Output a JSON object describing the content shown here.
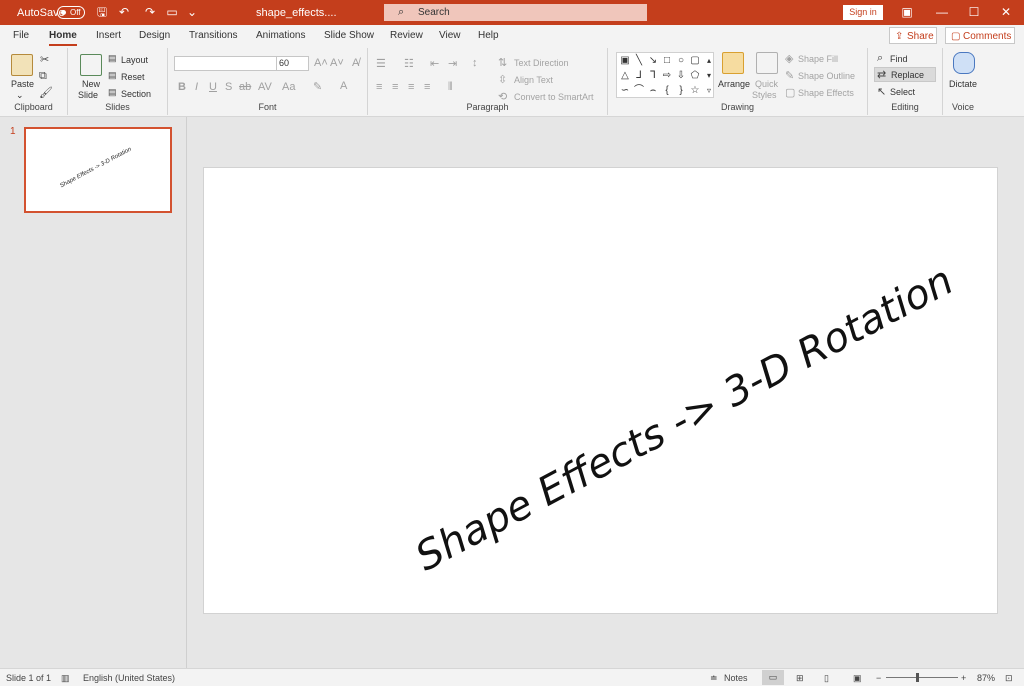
{
  "titlebar": {
    "autosave_label": "AutoSave",
    "autosave_state": "Off",
    "filename": "shape_effects....",
    "search_placeholder": "Search",
    "signin_label": "Sign in"
  },
  "tabs": [
    "File",
    "Home",
    "Insert",
    "Design",
    "Transitions",
    "Animations",
    "Slide Show",
    "Review",
    "View",
    "Help"
  ],
  "active_tab": "Home",
  "share_label": "Share",
  "comments_label": "Comments",
  "ribbon": {
    "clipboard": {
      "label": "Clipboard",
      "paste": "Paste"
    },
    "slides": {
      "label": "Slides",
      "new_slide_1": "New",
      "new_slide_2": "Slide",
      "layout": "Layout",
      "reset": "Reset",
      "section": "Section"
    },
    "font": {
      "label": "Font",
      "size": "60"
    },
    "paragraph": {
      "label": "Paragraph",
      "text_direction": "Text Direction",
      "align_text": "Align Text",
      "convert_smartart": "Convert to SmartArt"
    },
    "drawing": {
      "label": "Drawing",
      "arrange": "Arrange",
      "quick_styles_1": "Quick",
      "quick_styles_2": "Styles",
      "shape_fill": "Shape Fill",
      "shape_outline": "Shape Outline",
      "shape_effects": "Shape Effects"
    },
    "editing": {
      "label": "Editing",
      "find": "Find",
      "replace": "Replace",
      "select": "Select"
    },
    "voice": {
      "label": "Voice",
      "dictate": "Dictate"
    }
  },
  "slide_panel": {
    "slide_number": "1"
  },
  "slide": {
    "text": "Shape Effects -> 3-D Rotation"
  },
  "status": {
    "slide_info": "Slide 1 of 1",
    "language": "English (United States)",
    "notes": "Notes",
    "zoom": "87%"
  },
  "colors": {
    "accent": "#c43e1c",
    "background": "#e6e6e6"
  }
}
